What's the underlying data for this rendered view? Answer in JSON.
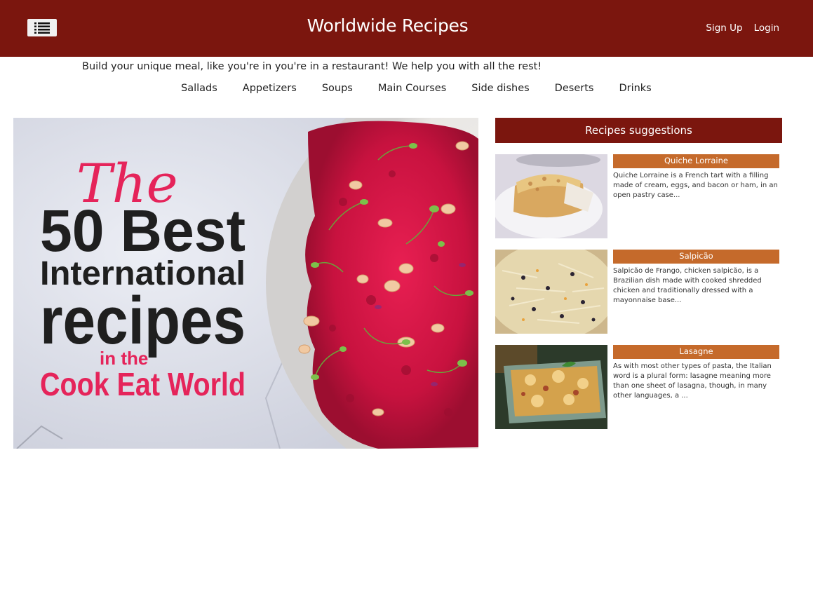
{
  "header": {
    "menu_icon": "list-icon",
    "title": "Worldwide Recipes",
    "signup_label": "Sign Up",
    "login_label": "Login"
  },
  "tagline": "Build your unique meal, like you're in you're in a restaurant! We help you with all the rest!",
  "categories": [
    "Sallads",
    "Appetizers",
    "Soups",
    "Main Courses",
    "Side dishes",
    "Deserts",
    "Drinks"
  ],
  "hero": {
    "line1": "The",
    "line2": "50 Best",
    "line3": "International",
    "line4": "recipes",
    "line5": "in the",
    "line6": "Cook Eat World"
  },
  "suggestions": {
    "title": "Recipes suggestions",
    "items": [
      {
        "name": "Quiche Lorraine",
        "desc": "Quiche Lorraine is a French tart with a filling made of cream, eggs, and bacon or ham, in an open pastry case..."
      },
      {
        "name": "Salpicão",
        "desc": "Salpicão de Frango, chicken salpicão, is a Brazilian dish made with cooked shredded chicken and traditionally dressed with a mayonnaise base..."
      },
      {
        "name": "Lasagne",
        "desc": "As with most other types of pasta, the Italian word is a plural form: lasagne meaning more than one sheet of lasagna, though, in many other languages, a ..."
      }
    ]
  },
  "colors": {
    "brand": "#7b160e",
    "accent": "#c56a2b",
    "title_pink": "#e5245a"
  }
}
